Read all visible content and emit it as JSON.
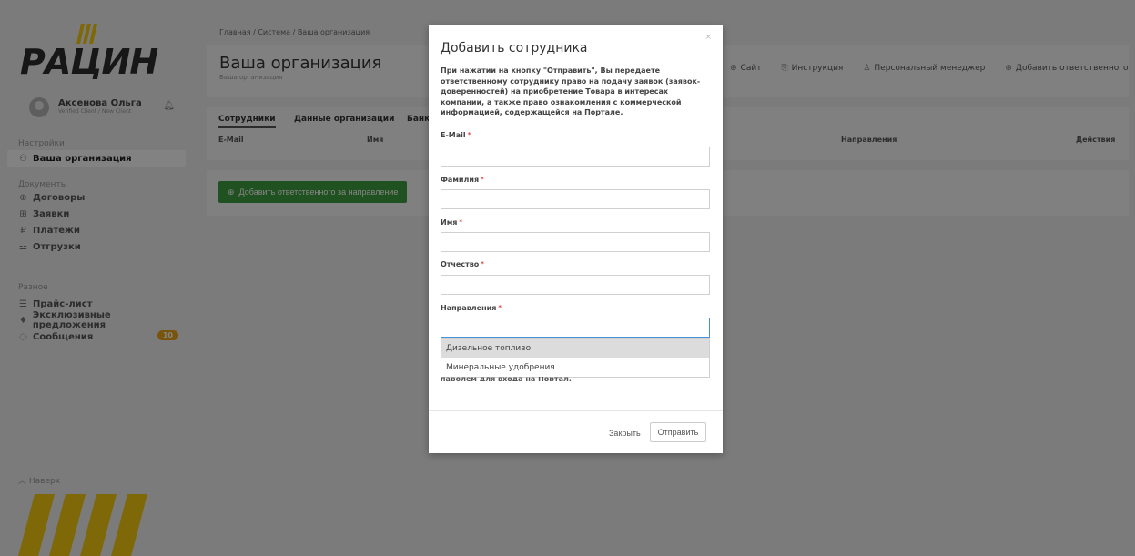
{
  "sidebar": {
    "logo": "РАЦИН",
    "user": {
      "name": "Аксенова Ольга",
      "role": "Verified Client / New Client"
    },
    "sections": {
      "settings": "Настройки",
      "documents": "Документы",
      "other": "Разное"
    },
    "items": {
      "org": "Ваша организация",
      "contracts": "Договоры",
      "requests": "Заявки",
      "payments": "Платежи",
      "shipments": "Отгрузки",
      "pricelist": "Прайс-лист",
      "exclusive": "Эксклюзивные предложения",
      "messages": "Сообщения",
      "messages_badge": "10"
    },
    "back": "Наверх"
  },
  "main": {
    "breadcrumb": "Главная / Система / Ваша организация",
    "title": "Ваша организация",
    "subtitle": "Ваша организация",
    "links": {
      "site": "Сайт",
      "instruction": "Инструкция",
      "manager": "Персональный менеджер",
      "add_responsible": "Добавить ответственного"
    },
    "tabs": [
      "Сотрудники",
      "Данные организации",
      "Банк"
    ],
    "columns": [
      "E-Mail",
      "Имя",
      "Направления",
      "Действия"
    ],
    "add_button": "Добавить ответственного за направление"
  },
  "modal": {
    "title": "Добавить сотрудника",
    "close_symbol": "×",
    "description": "При нажатии на кнопку \"Отправить\", Вы передаете ответственному сотруднику право на подачу заявок (заявок-доверенностей) на приобретение Товара в интересах компании, а также право ознакомления с коммерческой информацией, содержащейся на Портале.",
    "fields": {
      "email": "E-Mail",
      "lastname": "Фамилия",
      "firstname": "Имя",
      "middlename": "Отчество",
      "direction": "Направления"
    },
    "required_mark": "*",
    "dropdown_options": [
      "Дизельное топливо",
      "Минеральные удобрения"
    ],
    "hidden_hint": "паролем для входа на Портал.",
    "close_button": "Закрыть",
    "send_button": "Отправить"
  },
  "colors": {
    "accent_green": "#3f9b3f",
    "badge_orange": "#e8a317",
    "logo_yellow": "#f2c80f",
    "required_red": "#e03c3c"
  }
}
